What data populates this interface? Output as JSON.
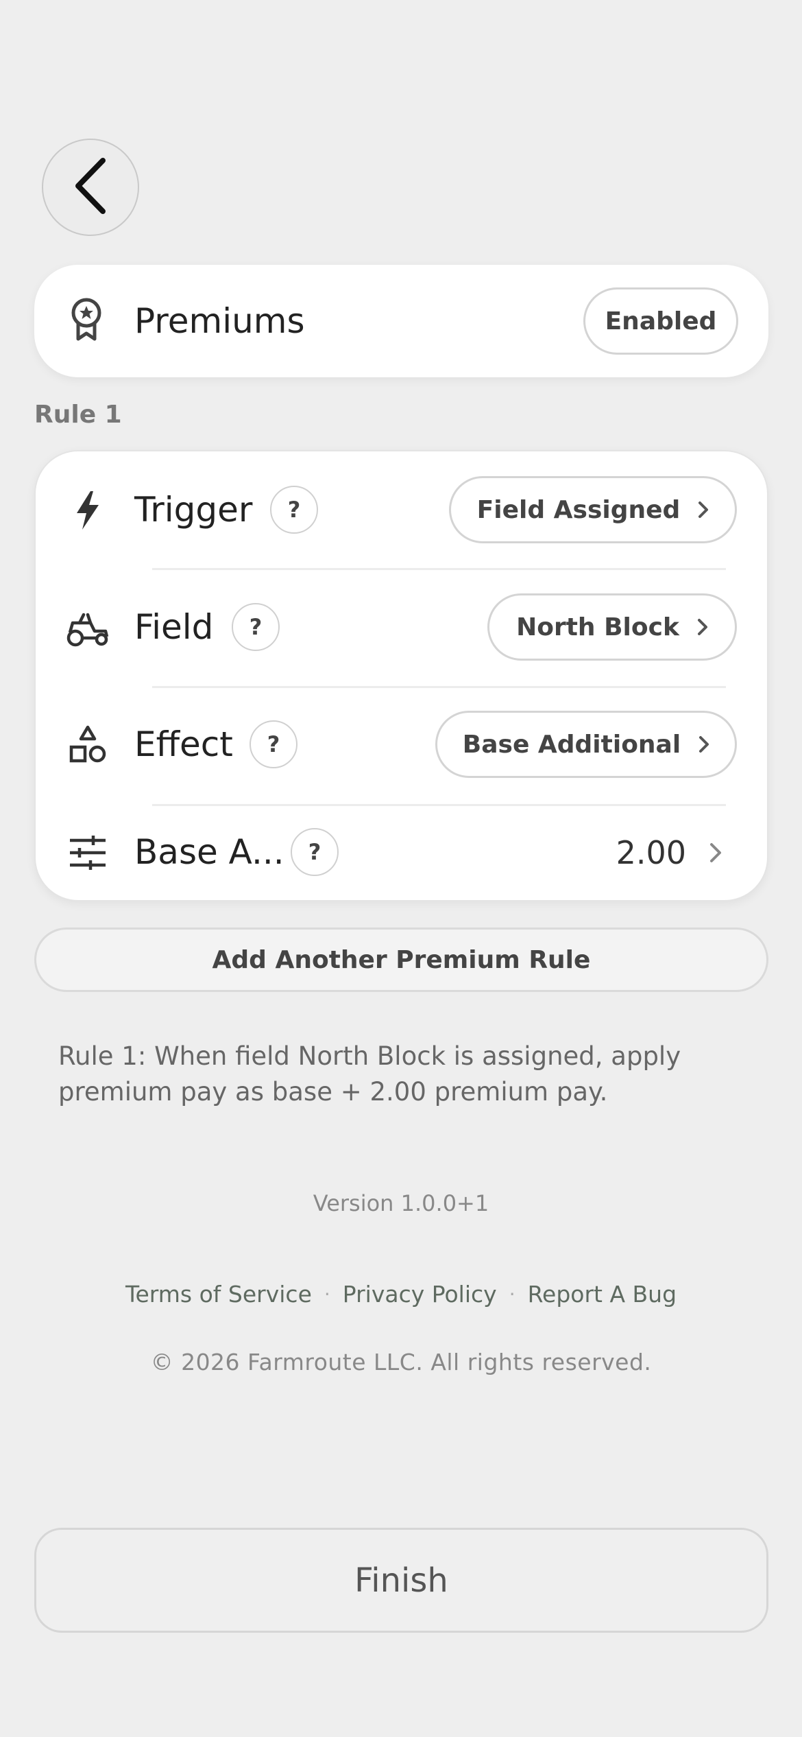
{
  "header": {
    "back_icon": "chevron-left-icon"
  },
  "premiums": {
    "icon": "award-ribbon-icon",
    "label": "Premiums",
    "status": "Enabled"
  },
  "rule": {
    "title": "Rule 1",
    "rows": [
      {
        "icon": "lightning-icon",
        "label": "Trigger",
        "help": "?",
        "value": "Field Assigned"
      },
      {
        "icon": "tractor-icon",
        "label": "Field",
        "help": "?",
        "value": "North Block"
      },
      {
        "icon": "shapes-icon",
        "label": "Effect",
        "help": "?",
        "value": "Base Additional"
      },
      {
        "icon": "sliders-icon",
        "label": "Base A...",
        "help": "?",
        "value": "2.00"
      }
    ]
  },
  "add_rule_label": "Add Another Premium Rule",
  "summary": "Rule 1: When field North Block is assigned, apply premium pay as base + 2.00 premium pay.",
  "footer": {
    "version": "Version 1.0.0+1",
    "links": [
      "Terms of Service",
      "Privacy Policy",
      "Report A Bug"
    ],
    "separator": "·",
    "copyright": "© 2026 Farmroute LLC. All rights reserved."
  },
  "finish_label": "Finish"
}
